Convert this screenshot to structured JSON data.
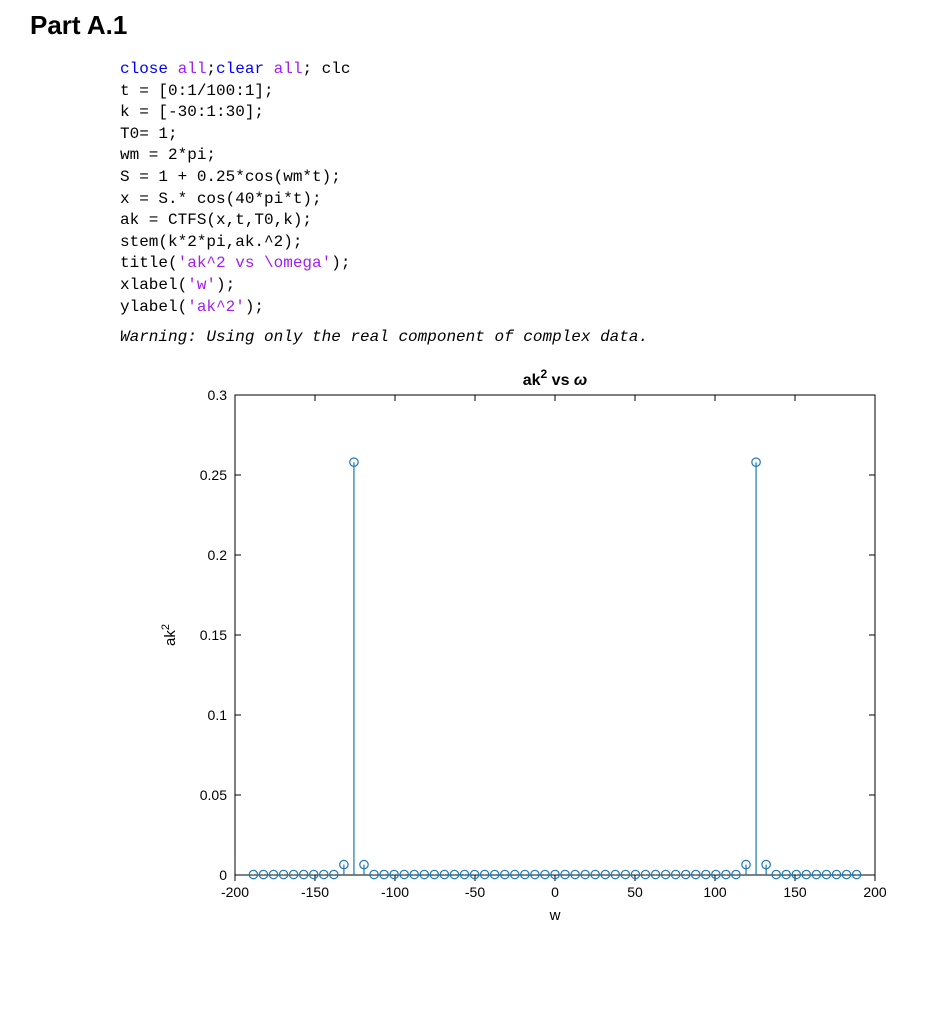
{
  "heading": "Part A.1",
  "code_tokens": [
    [
      {
        "t": "close ",
        "c": "kw"
      },
      {
        "t": "all",
        "c": "str"
      },
      {
        "t": ";"
      },
      {
        "t": "clear ",
        "c": "kw"
      },
      {
        "t": "all",
        "c": "str"
      },
      {
        "t": "; clc"
      }
    ],
    [
      {
        "t": "t = [0:1/100:1];"
      }
    ],
    [
      {
        "t": "k = [-30:1:30];"
      }
    ],
    [
      {
        "t": "T0= 1;"
      }
    ],
    [
      {
        "t": "wm = 2*pi;"
      }
    ],
    [
      {
        "t": "S = 1 + 0.25*cos(wm*t);"
      }
    ],
    [
      {
        "t": "x = S.* cos(40*pi*t);"
      }
    ],
    [
      {
        "t": "ak = CTFS(x,t,T0,k);"
      }
    ],
    [
      {
        "t": "stem(k*2*pi,ak.^2);"
      }
    ],
    [
      {
        "t": "title("
      },
      {
        "t": "'ak^2 vs \\omega'",
        "c": "str"
      },
      {
        "t": ");"
      }
    ],
    [
      {
        "t": "xlabel("
      },
      {
        "t": "'w'",
        "c": "str"
      },
      {
        "t": ");"
      }
    ],
    [
      {
        "t": "ylabel("
      },
      {
        "t": "'ak^2'",
        "c": "str"
      },
      {
        "t": ");"
      }
    ]
  ],
  "warning": "Warning: Using only the real component of complex data.",
  "chart_data": {
    "type": "stem",
    "title": "ak^2 vs ω",
    "title_parts": {
      "prefix": "ak",
      "sup": "2",
      "middle": " vs ",
      "omega": "ω"
    },
    "xlabel": "w",
    "ylabel": "ak^2",
    "ylabel_parts": {
      "prefix": "ak",
      "sup": "2"
    },
    "xlim": [
      -200,
      200
    ],
    "ylim": [
      0,
      0.3
    ],
    "xticks": [
      -200,
      -150,
      -100,
      -50,
      0,
      50,
      100,
      150,
      200
    ],
    "yticks": [
      0,
      0.05,
      0.1,
      0.15,
      0.2,
      0.25,
      0.3
    ],
    "color": "#1f77b4",
    "peaks": {
      "main": 0.258,
      "side": 0.0065,
      "main_x": [
        -125.66,
        125.66
      ],
      "side_x": [
        -131.95,
        -119.38,
        119.38,
        131.95
      ]
    },
    "data_note": "x = k*2π for k in [-30..30]; ak^2 ≈ 0.258 at k=±20, ≈0.0065 at k=±19,±21, otherwise ≈0."
  }
}
